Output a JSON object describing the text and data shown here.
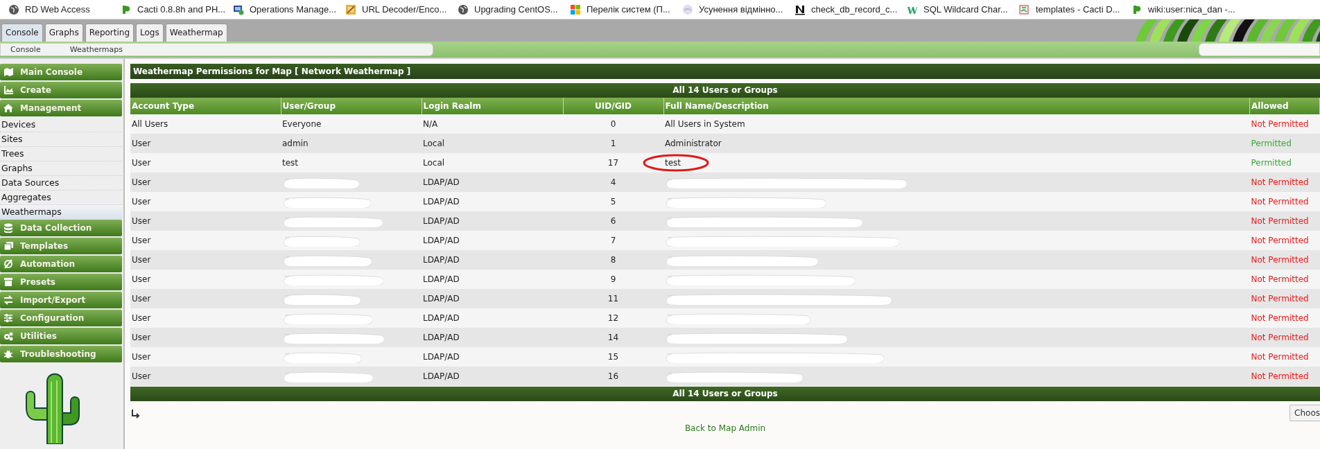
{
  "bookmarks": [
    {
      "label": "RD Web Access"
    },
    {
      "label": "Cacti 0.8.8h and PH..."
    },
    {
      "label": "Operations Manage..."
    },
    {
      "label": "URL Decoder/Enco..."
    },
    {
      "label": "Upgrading CentOS..."
    },
    {
      "label": "Перелік систем (П..."
    },
    {
      "label": "Усунення відмінно..."
    },
    {
      "label": "check_db_record_c..."
    },
    {
      "label": "SQL Wildcard Char..."
    },
    {
      "label": "templates - Cacti D..."
    },
    {
      "label": "wiki:user:nica_dan -..."
    }
  ],
  "tabs": [
    {
      "label": "Console",
      "selected": true
    },
    {
      "label": "Graphs",
      "selected": false
    },
    {
      "label": "Reporting",
      "selected": false
    },
    {
      "label": "Logs",
      "selected": false
    },
    {
      "label": "Weathermap",
      "selected": false
    }
  ],
  "breadcrumbs": [
    "Console",
    "Weathermaps"
  ],
  "sidebar": {
    "items": [
      {
        "kind": "section",
        "label": "Main Console",
        "selected": false
      },
      {
        "kind": "section",
        "label": "Create",
        "selected": false
      },
      {
        "kind": "section",
        "label": "Management",
        "selected": false
      },
      {
        "kind": "link",
        "label": "Devices",
        "selected": false
      },
      {
        "kind": "link",
        "label": "Sites",
        "selected": false
      },
      {
        "kind": "link",
        "label": "Trees",
        "selected": false
      },
      {
        "kind": "link",
        "label": "Graphs",
        "selected": false
      },
      {
        "kind": "link",
        "label": "Data Sources",
        "selected": false
      },
      {
        "kind": "link",
        "label": "Aggregates",
        "selected": false
      },
      {
        "kind": "link",
        "label": "Weathermaps",
        "selected": true
      },
      {
        "kind": "section",
        "label": "Data Collection",
        "selected": false
      },
      {
        "kind": "section",
        "label": "Templates",
        "selected": false
      },
      {
        "kind": "section",
        "label": "Automation",
        "selected": false
      },
      {
        "kind": "section",
        "label": "Presets",
        "selected": false
      },
      {
        "kind": "section",
        "label": "Import/Export",
        "selected": false
      },
      {
        "kind": "section",
        "label": "Configuration",
        "selected": false
      },
      {
        "kind": "section",
        "label": "Utilities",
        "selected": false
      },
      {
        "kind": "section",
        "label": "Troubleshooting",
        "selected": false
      }
    ]
  },
  "panel": {
    "title": "Weathermap Permissions for Map [ Network Weathermap ]",
    "group_header": "All 14 Users or Groups",
    "group_footer": "All 14 Users or Groups",
    "columns": [
      "Account Type",
      "User/Group",
      "Login Realm",
      "UID/GID",
      "Full Name/Description",
      "Allowed"
    ],
    "rows": [
      {
        "account_type": "All Users",
        "user_group": {
          "text": "Everyone"
        },
        "login_realm": "N/A",
        "uid_gid": "0",
        "full_name": {
          "text": "All Users in System"
        },
        "allowed": "Not Permitted",
        "permitted": false,
        "circled": false
      },
      {
        "account_type": "User",
        "user_group": {
          "text": "admin"
        },
        "login_realm": "Local",
        "uid_gid": "1",
        "full_name": {
          "text": "Administrator"
        },
        "allowed": "Permitted",
        "permitted": true,
        "circled": false
      },
      {
        "account_type": "User",
        "user_group": {
          "text": "test"
        },
        "login_realm": "Local",
        "uid_gid": "17",
        "full_name": {
          "text": "test"
        },
        "allowed": "Permitted",
        "permitted": true,
        "circled": true
      },
      {
        "account_type": "User",
        "user_group": {
          "redacted": true
        },
        "login_realm": "LDAP/AD",
        "uid_gid": "4",
        "full_name": {
          "redacted": true
        },
        "allowed": "Not Permitted",
        "permitted": false,
        "circled": false
      },
      {
        "account_type": "User",
        "user_group": {
          "redacted": true
        },
        "login_realm": "LDAP/AD",
        "uid_gid": "5",
        "full_name": {
          "redacted": true
        },
        "allowed": "Not Permitted",
        "permitted": false,
        "circled": false
      },
      {
        "account_type": "User",
        "user_group": {
          "redacted": true
        },
        "login_realm": "LDAP/AD",
        "uid_gid": "6",
        "full_name": {
          "redacted": true
        },
        "allowed": "Not Permitted",
        "permitted": false,
        "circled": false
      },
      {
        "account_type": "User",
        "user_group": {
          "redacted": true
        },
        "login_realm": "LDAP/AD",
        "uid_gid": "7",
        "full_name": {
          "redacted": true
        },
        "allowed": "Not Permitted",
        "permitted": false,
        "circled": false
      },
      {
        "account_type": "User",
        "user_group": {
          "redacted": true
        },
        "login_realm": "LDAP/AD",
        "uid_gid": "8",
        "full_name": {
          "redacted": true
        },
        "allowed": "Not Permitted",
        "permitted": false,
        "circled": false
      },
      {
        "account_type": "User",
        "user_group": {
          "redacted": true
        },
        "login_realm": "LDAP/AD",
        "uid_gid": "9",
        "full_name": {
          "redacted": true
        },
        "allowed": "Not Permitted",
        "permitted": false,
        "circled": false
      },
      {
        "account_type": "User",
        "user_group": {
          "redacted": true
        },
        "login_realm": "LDAP/AD",
        "uid_gid": "11",
        "full_name": {
          "redacted": true
        },
        "allowed": "Not Permitted",
        "permitted": false,
        "circled": false
      },
      {
        "account_type": "User",
        "user_group": {
          "redacted": true
        },
        "login_realm": "LDAP/AD",
        "uid_gid": "12",
        "full_name": {
          "redacted": true
        },
        "allowed": "Not Permitted",
        "permitted": false,
        "circled": false
      },
      {
        "account_type": "User",
        "user_group": {
          "redacted": true
        },
        "login_realm": "LDAP/AD",
        "uid_gid": "14",
        "full_name": {
          "redacted": true
        },
        "allowed": "Not Permitted",
        "permitted": false,
        "circled": false
      },
      {
        "account_type": "User",
        "user_group": {
          "redacted": true
        },
        "login_realm": "LDAP/AD",
        "uid_gid": "15",
        "full_name": {
          "redacted": true
        },
        "allowed": "Not Permitted",
        "permitted": false,
        "circled": false
      },
      {
        "account_type": "User",
        "user_group": {
          "redacted": true
        },
        "login_realm": "LDAP/AD",
        "uid_gid": "16",
        "full_name": {
          "redacted": true
        },
        "allowed": "Not Permitted",
        "permitted": false,
        "circled": false
      }
    ],
    "choose_button": "Choos",
    "back_link": "Back to Map Admin"
  }
}
